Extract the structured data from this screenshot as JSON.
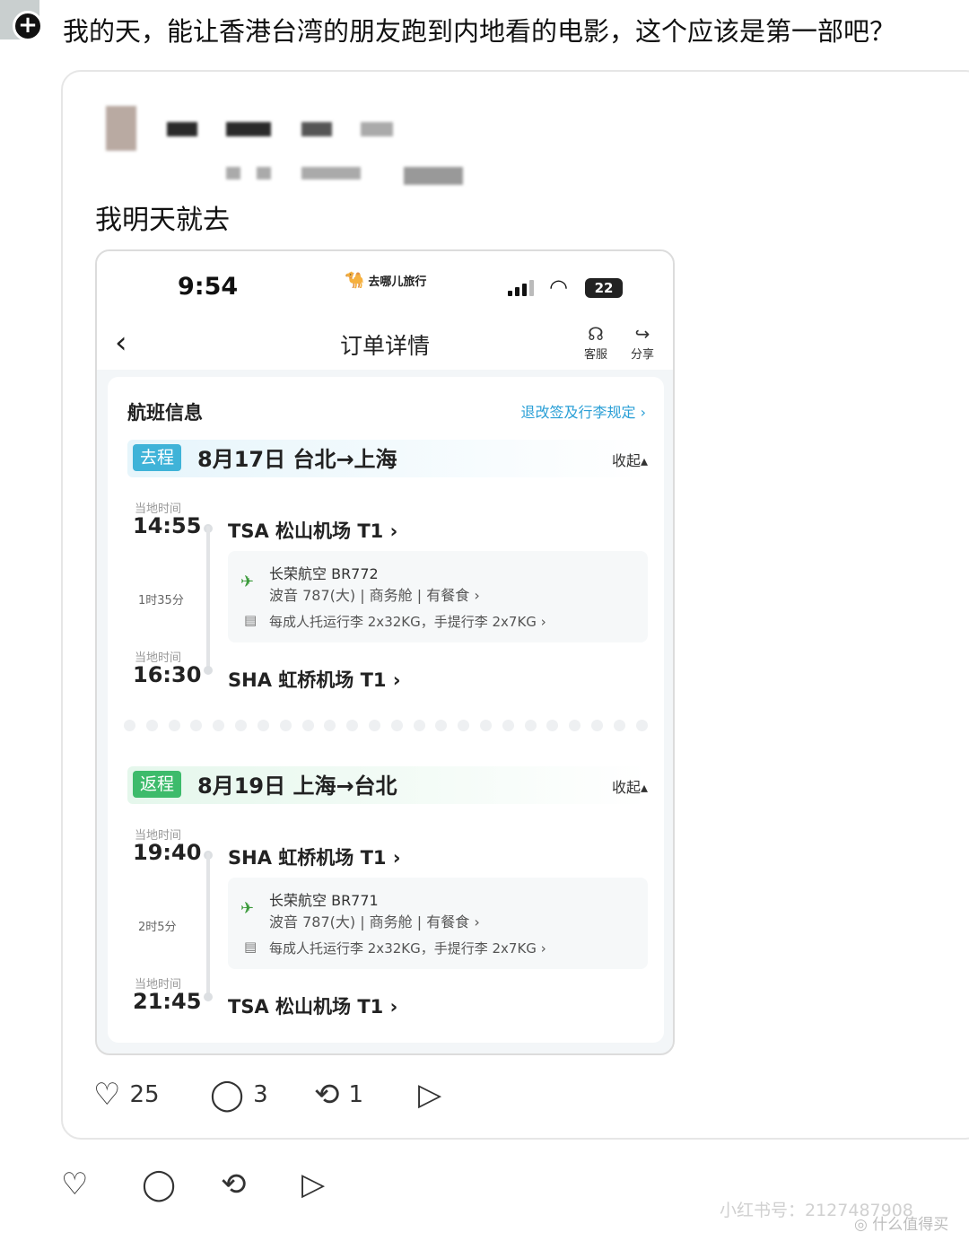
{
  "post": {
    "text": "我的天，能让香港台湾的朋友跑到内地看的电影，这个应该是第一部吧？"
  },
  "quote": {
    "text": "我明天就去"
  },
  "app": {
    "status_time": "9:54",
    "brand_name": "去哪儿旅行",
    "battery": "22",
    "page_title": "订单详情",
    "service_label": "客服",
    "share_label": "分享"
  },
  "flight_info": {
    "title": "航班信息",
    "rules_link": "退改签及行李规定 ›",
    "legs": [
      {
        "tag": "去程",
        "tag_color": "#3fb3d8",
        "title": "8月17日 台北→上海",
        "collapse": "收起▴",
        "dep_label": "当地时间",
        "dep_time": "14:55",
        "dep_airport": "TSA 松山机场 T1 ›",
        "duration": "1时35分",
        "airline": "长荣航空 BR772",
        "aircraft": "波音 787(大)  |  商务舱  |  有餐食 ›",
        "baggage": "每成人托运行李 2x32KG，手提行李 2x7KG ›",
        "arr_label": "当地时间",
        "arr_time": "16:30",
        "arr_airport": "SHA 虹桥机场 T1 ›"
      },
      {
        "tag": "返程",
        "tag_color": "#3dbb6b",
        "title": "8月19日 上海→台北",
        "collapse": "收起▴",
        "dep_label": "当地时间",
        "dep_time": "19:40",
        "dep_airport": "SHA 虹桥机场 T1 ›",
        "duration": "2时5分",
        "airline": "长荣航空 BR771",
        "aircraft": "波音 787(大)  |  商务舱  |  有餐食 ›",
        "baggage": "每成人托运行李 2x32KG，手提行李 2x7KG ›",
        "arr_label": "当地时间",
        "arr_time": "21:45",
        "arr_airport": "TSA 松山机场 T1 ›"
      }
    ]
  },
  "quote_actions": {
    "likes": "25",
    "comments": "3",
    "reposts": "1"
  },
  "watermarks": {
    "xhs_id": "小红书号：2127487908",
    "smzdm": "什么值得买"
  },
  "icons": {
    "like": "heart-icon",
    "comment": "comment-bubble-icon",
    "repost": "repost-icon",
    "share": "send-icon"
  }
}
